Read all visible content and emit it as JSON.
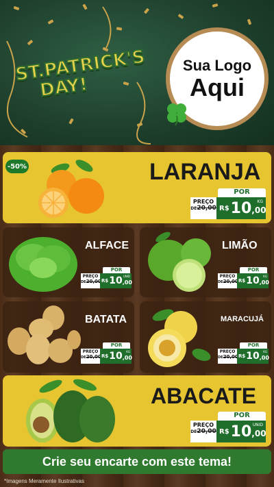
{
  "header": {
    "title_line1": "ST.PATRICK'S",
    "title_line2": "DAY!",
    "logo_line1": "Sua Logo",
    "logo_line2": "Aqui"
  },
  "featured_top": {
    "discount": "-50%",
    "name": "LARANJA",
    "por_label": "POR",
    "preco_label": "PREÇO",
    "de_label": "DE",
    "old_price": "20,00",
    "currency": "R$",
    "price_int": "10",
    "price_dec": ",00",
    "unit": "KG"
  },
  "products": [
    {
      "name": "ALFACE",
      "por_label": "POR",
      "preco_label": "PREÇO",
      "de_label": "DE",
      "old_price": "20,00",
      "currency": "R$",
      "price_int": "10",
      "price_dec": ",00",
      "unit": "UNID"
    },
    {
      "name": "LIMÃO",
      "por_label": "POR",
      "preco_label": "PREÇO",
      "de_label": "DE",
      "old_price": "20,00",
      "currency": "R$",
      "price_int": "10",
      "price_dec": ",00",
      "unit": "KG"
    },
    {
      "name": "BATATA",
      "por_label": "POR",
      "preco_label": "PREÇO",
      "de_label": "DE",
      "old_price": "20,00",
      "currency": "R$",
      "price_int": "10",
      "price_dec": ",00",
      "unit": "KG"
    },
    {
      "name": "MARACUJÁ",
      "por_label": "POR",
      "preco_label": "PREÇO",
      "de_label": "DE",
      "old_price": "20,00",
      "currency": "R$",
      "price_int": "10",
      "price_dec": ",00",
      "unit": "KG"
    }
  ],
  "featured_bottom": {
    "name": "ABACATE",
    "por_label": "POR",
    "preco_label": "PREÇO",
    "de_label": "DE",
    "old_price": "20,00",
    "currency": "R$",
    "price_int": "10",
    "price_dec": ",00",
    "unit": "UNID"
  },
  "footer": {
    "cta": "Crie seu encarte com este tema!",
    "disclaimer": "*Imagens Meramente Ilustrativas"
  },
  "colors": {
    "header_green": "#1e3f2c",
    "yellow_card": "#e6c530",
    "price_green": "#1f6e2c",
    "wood": "#4a2c17"
  }
}
